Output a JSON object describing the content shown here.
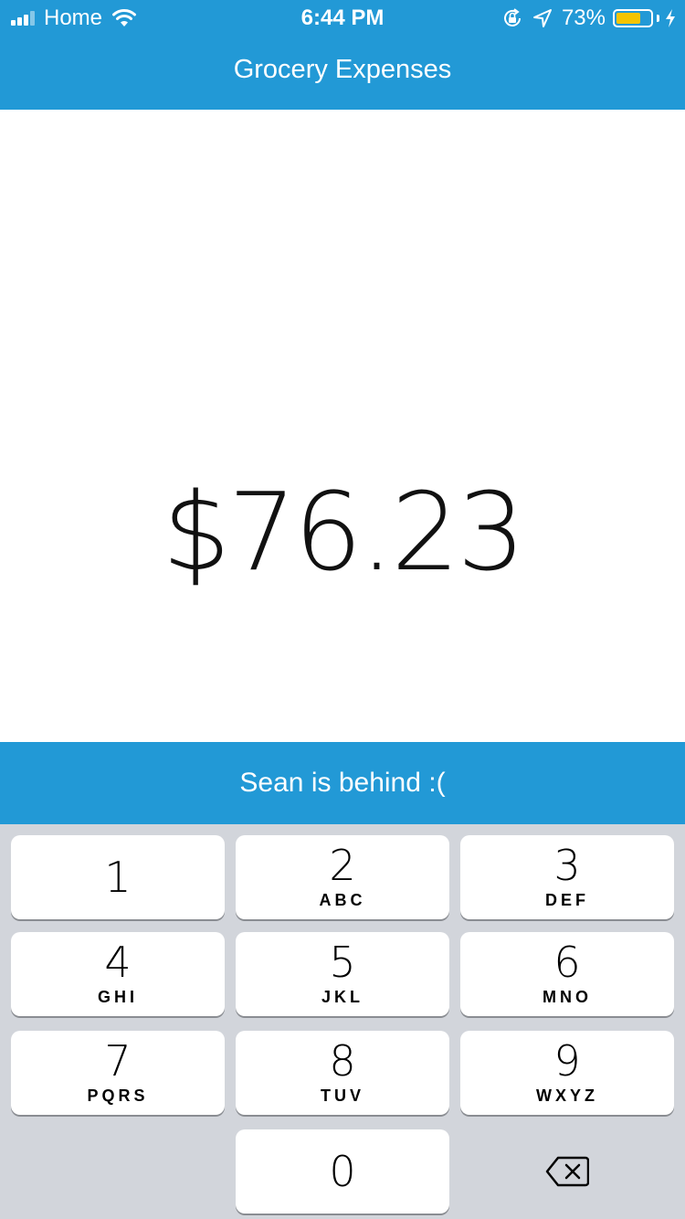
{
  "status_bar": {
    "carrier": "Home",
    "time": "6:44 PM",
    "battery_percent": "73%",
    "battery_level": 0.73,
    "icons": [
      "signal-icon",
      "wifi-icon",
      "orientation-lock-icon",
      "location-arrow-icon",
      "battery-icon",
      "charging-bolt-icon"
    ]
  },
  "header": {
    "title": "Grocery Expenses"
  },
  "main": {
    "amount": "$76.23"
  },
  "banner": {
    "text": "Sean is behind :("
  },
  "keypad": {
    "keys": [
      {
        "digit": "1",
        "letters": ""
      },
      {
        "digit": "2",
        "letters": "ABC"
      },
      {
        "digit": "3",
        "letters": "DEF"
      },
      {
        "digit": "4",
        "letters": "GHI"
      },
      {
        "digit": "5",
        "letters": "JKL"
      },
      {
        "digit": "6",
        "letters": "MNO"
      },
      {
        "digit": "7",
        "letters": "PQRS"
      },
      {
        "digit": "8",
        "letters": "TUV"
      },
      {
        "digit": "9",
        "letters": "WXYZ"
      },
      {
        "digit": "0",
        "letters": ""
      }
    ],
    "delete_icon": "backspace-icon"
  },
  "colors": {
    "accent": "#2299d6",
    "keypad_background": "#d2d5db",
    "battery_fill": "#f5c400"
  }
}
